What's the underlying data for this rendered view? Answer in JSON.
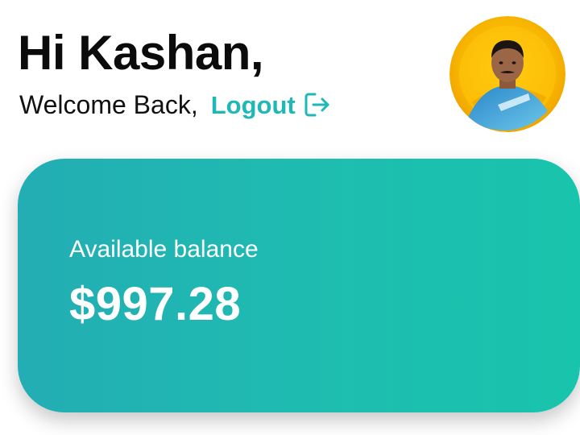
{
  "header": {
    "greeting": "Hi Kashan,",
    "welcome": "Welcome Back,",
    "logout_label": "Logout",
    "logout_icon": "logout-icon",
    "avatar_icon": "user-avatar-photo"
  },
  "balance_card": {
    "label": "Available balance",
    "amount": "$997.28"
  },
  "colors": {
    "accent": "#1fb8b6",
    "card_gradient_start": "#23adb4",
    "card_gradient_end": "#19c4ac",
    "avatar_ring": "#f6b800"
  }
}
